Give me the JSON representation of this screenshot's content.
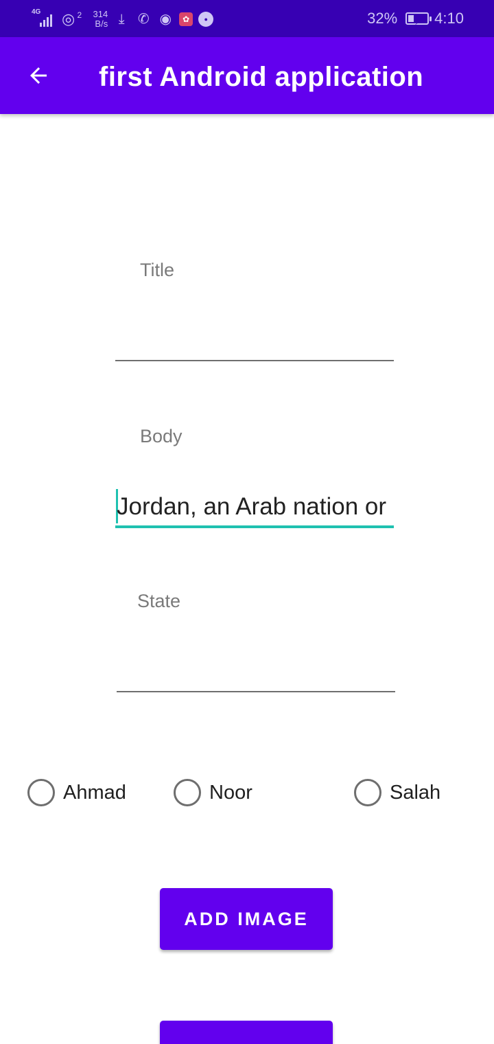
{
  "status_bar": {
    "network_type": "4G",
    "hotspot_count": "2",
    "speed_value": "314",
    "speed_unit": "B/s",
    "battery": "32%",
    "battery_level": 0.32,
    "time": "4:10"
  },
  "app_bar": {
    "title": "first Android application",
    "back_icon": "arrow-back-icon"
  },
  "form": {
    "title_field": {
      "label": "Title",
      "value": ""
    },
    "body_field": {
      "label": "Body",
      "value": "Jordan, an Arab nation or"
    },
    "state_field": {
      "label": "State",
      "value": ""
    }
  },
  "radio_group": {
    "options": [
      {
        "label": "Ahmad",
        "selected": false
      },
      {
        "label": "Noor",
        "selected": false
      },
      {
        "label": "Salah",
        "selected": false
      }
    ]
  },
  "buttons": {
    "add_image": "ADD IMAGE",
    "second_button": ""
  },
  "colors": {
    "status_bar": "#3700b3",
    "primary": "#6200ee",
    "accent": "#1fc1b0"
  }
}
